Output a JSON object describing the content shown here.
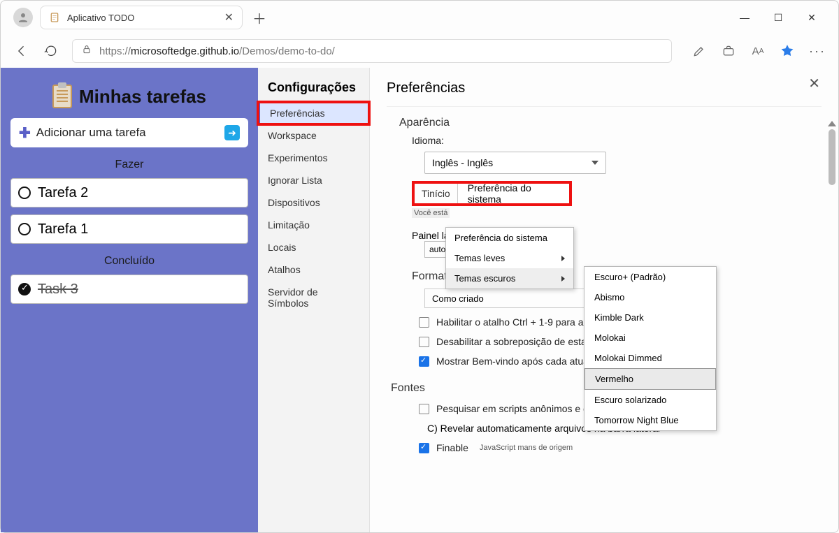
{
  "tab": {
    "title": "Aplicativo TODO"
  },
  "url": {
    "scheme": "https://",
    "host": "microsoftedge.github.io",
    "path": "/Demos/demo-to-do/"
  },
  "todo": {
    "title": "Minhas tarefas",
    "add": "Adicionar uma tarefa",
    "section_todo": "Fazer",
    "section_done": "Concluído",
    "tasks_open": [
      "Tarefa 2",
      "Tarefa 1"
    ],
    "tasks_done": [
      "Task 3"
    ]
  },
  "settings": {
    "title": "Configurações",
    "items": [
      "Preferências",
      "Workspace",
      "Experimentos",
      "Ignorar Lista",
      "Dispositivos",
      "Limitação",
      "Locais",
      "Atalhos",
      "Servidor de Símbolos"
    ],
    "active_index": 0
  },
  "prefs": {
    "title": "Preferências",
    "appearance": "Aparência",
    "language_label": "Idioma:",
    "language_value": "Inglês - Inglês",
    "theme_label": "Tinício",
    "theme_value": "Preferência do sistema",
    "tiny_note": "Você está",
    "panel_label": "Painel lay",
    "panel_value": "automática",
    "color_format_label": "Formato de cor: O",
    "color_format_value": "Como criado",
    "cb1": "Habilitar o atalho Ctrl + 1-9 para alternar",
    "cb2": "Desabilitar a sobreposição de estado pausada",
    "cb3": "Mostrar Bem-vindo após cada atualização",
    "fonts": "Fontes",
    "cb4": "Pesquisar em scripts anônimos e de conteúdo",
    "reveal": "C) Revelar automaticamente arquivos na barra lateral",
    "cb5": "Finable",
    "cb5_note": "JavaScript mans de origem"
  },
  "menu1": {
    "items": [
      {
        "label": "Preferência do sistema",
        "sub": false
      },
      {
        "label": "Temas leves",
        "sub": true
      },
      {
        "label": "Temas escuros",
        "sub": true,
        "open": true
      }
    ]
  },
  "menu2": {
    "items": [
      "Escuro+ (Padrão)",
      "Abismo",
      "Kimble Dark",
      "Molokai",
      "Molokai Dimmed",
      "Vermelho",
      "Escuro solarizado",
      "Tomorrow Night Blue"
    ],
    "hover_index": 5
  }
}
